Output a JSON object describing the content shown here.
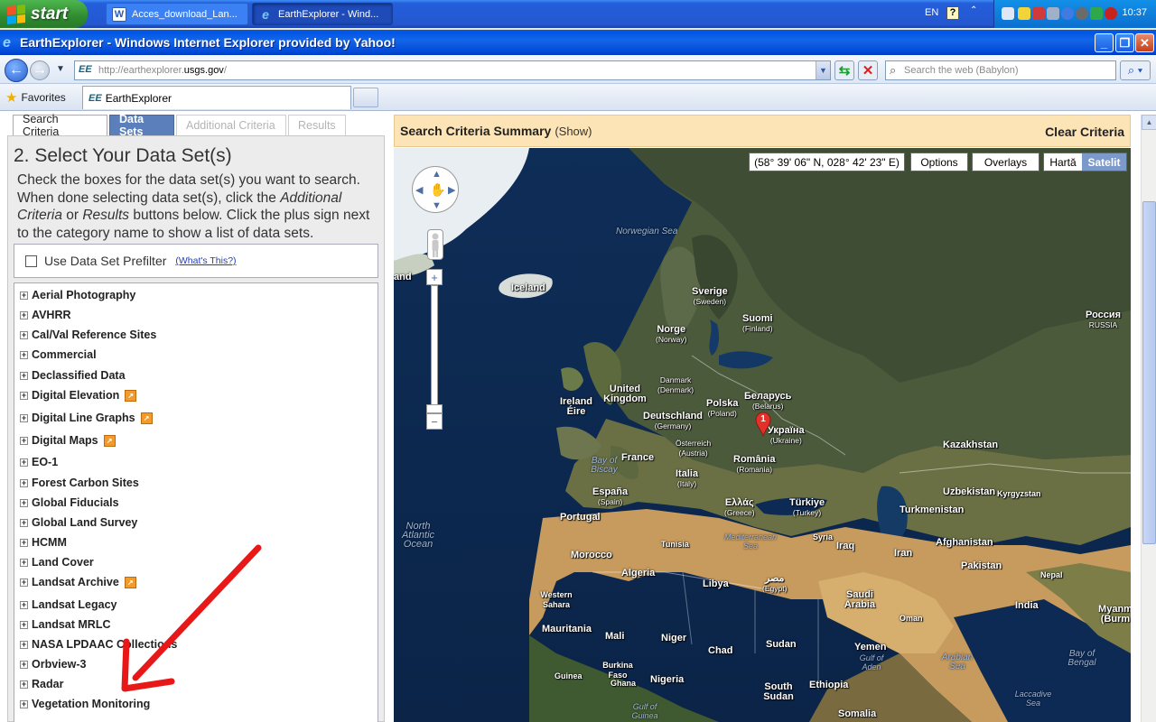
{
  "taskbar": {
    "start_label": "start",
    "tasks": [
      {
        "label": "Acces_download_Lan..."
      },
      {
        "label": "EarthExplorer - Wind..."
      }
    ],
    "lang": "EN",
    "help": "?",
    "clock": "10:37"
  },
  "window": {
    "title": "EarthExplorer - Windows Internet Explorer provided by Yahoo!"
  },
  "address": {
    "url_prefix": "http://earthexplorer.",
    "url_domain": "usgs.gov",
    "url_suffix": "/",
    "search_placeholder": "Search the web (Babylon)"
  },
  "favorites": {
    "label": "Favorites",
    "tab_title": "EarthExplorer"
  },
  "tabs": [
    {
      "label": "Search Criteria",
      "state": "normal"
    },
    {
      "label": "Data Sets",
      "state": "active"
    },
    {
      "label": "Additional Criteria",
      "state": "disabled"
    },
    {
      "label": "Results",
      "state": "disabled"
    }
  ],
  "section": {
    "title": "2. Select Your Data Set(s)",
    "instr_1": "Check the boxes for the data set(s) you want to search. When done selecting data set(s), click the ",
    "instr_addl": "Additional Criteria",
    "instr_2": " or ",
    "instr_results": "Results",
    "instr_3": " buttons below. Click the plus sign next to the category name to show a list of data sets."
  },
  "prefilter": {
    "label": "Use Data Set Prefilter",
    "whats_this": "(What's This?)"
  },
  "datasets": [
    {
      "label": "Aerial Photography",
      "pin": false
    },
    {
      "label": "AVHRR",
      "pin": false
    },
    {
      "label": "Cal/Val Reference Sites",
      "pin": false
    },
    {
      "label": "Commercial",
      "pin": false
    },
    {
      "label": "Declassified Data",
      "pin": false
    },
    {
      "label": "Digital Elevation",
      "pin": true
    },
    {
      "label": "Digital Line Graphs",
      "pin": true
    },
    {
      "label": "Digital Maps",
      "pin": true
    },
    {
      "label": "EO-1",
      "pin": false
    },
    {
      "label": "Forest Carbon Sites",
      "pin": false
    },
    {
      "label": "Global Fiducials",
      "pin": false
    },
    {
      "label": "Global Land Survey",
      "pin": false
    },
    {
      "label": "HCMM",
      "pin": false
    },
    {
      "label": "Land Cover",
      "pin": false
    },
    {
      "label": "Landsat Archive",
      "pin": true
    },
    {
      "label": "Landsat Legacy",
      "pin": false
    },
    {
      "label": "Landsat MRLC",
      "pin": false
    },
    {
      "label": "NASA LPDAAC Collections",
      "pin": false
    },
    {
      "label": "Orbview-3",
      "pin": false
    },
    {
      "label": "Radar",
      "pin": false
    },
    {
      "label": "Vegetation Monitoring",
      "pin": false
    }
  ],
  "summary": {
    "title": "Search Criteria Summary",
    "show": "(Show)",
    "clear": "Clear Criteria"
  },
  "map": {
    "coords": "(58° 39' 06\" N, 028° 42' 23\" E)",
    "options": "Options",
    "overlays": "Overlays",
    "harta": "Hartă",
    "satelit": "Satelit",
    "marker_number": "1",
    "labels": {
      "iceland": "Iceland",
      "land_edge": "and",
      "norwegian_sea": "Norwegian Sea",
      "sverige": "Sverige",
      "sverige_sub": "(Sweden)",
      "norge": "Norge",
      "norge_sub": "(Norway)",
      "suomi": "Suomi",
      "suomi_sub": "(Finland)",
      "rossiya": "Россия",
      "rossiya_sub": "RUSSIA",
      "danmark": "Danmark",
      "danmark_sub": "(Denmark)",
      "uk": "United Kingdom",
      "ireland": "Ireland Éire",
      "polska": "Polska",
      "polska_sub": "(Poland)",
      "belarus": "Беларусь",
      "belarus_sub": "(Belarus)",
      "deutschland": "Deutschland",
      "deutschland_sub": "(Germany)",
      "ukraina": "Україна",
      "ukraina_sub": "(Ukraine)",
      "osterreich": "Österreich",
      "osterreich_sub": "(Austria)",
      "kazakhstan": "Kazakhstan",
      "france": "France",
      "romania": "România",
      "romania_sub": "(Romania)",
      "bay_biscay": "Bay of Biscay",
      "italia": "Italia",
      "italia_sub": "(Italy)",
      "espana": "España",
      "espana_sub": "(Spain)",
      "ellas": "Ελλάς",
      "ellas_sub": "(Greece)",
      "turkiye": "Türkiye",
      "turkiye_sub": "(Turkey)",
      "uzbekistan": "Uzbekistan",
      "kyrgyzstan": "Kyrgyzstan",
      "turkmenistan": "Turkmenistan",
      "portugal": "Portugal",
      "north_atlantic": "North Atlantic Ocean",
      "tunisia": "Tunisia",
      "mediterranean": "Mediterranean Sea",
      "syria": "Syria",
      "iraq": "Iraq",
      "iran": "Iran",
      "afghanistan": "Afghanistan",
      "morocco": "Morocco",
      "algeria": "Algeria",
      "libya": "Libya",
      "misr": "مصر",
      "misr_sub": "(Egypt)",
      "pakistan": "Pakistan",
      "nepal": "Nepal",
      "western_sahara": "Western Sahara",
      "saudi": "Saudi Arabia",
      "oman": "Oman",
      "india": "India",
      "myanmar": "Myanm (Burm",
      "mauritania": "Mauritania",
      "mali": "Mali",
      "niger": "Niger",
      "chad": "Chad",
      "sudan": "Sudan",
      "yemen": "Yemen",
      "gulf_aden": "Gulf of Aden",
      "arabian_sea": "Arabian Sea",
      "bay_bengal": "Bay of Bengal",
      "guinea": "Guinea",
      "burkina": "Burkina Faso",
      "ghana": "Ghana",
      "nigeria": "Nigeria",
      "south_sudan": "South Sudan",
      "ethiopia": "Ethiopia",
      "gulf_guinea": "Gulf of Guinea",
      "somalia": "Somalia",
      "laccadive": "Laccadive Sea"
    }
  },
  "colors": {
    "taskbar_blue": "#245edb",
    "start_green": "#3c9a3c",
    "tab_active": "#5a7fba",
    "summary_bg": "#fde4b6",
    "pin_orange": "#f29a2a",
    "arrow_red": "#e81818"
  }
}
